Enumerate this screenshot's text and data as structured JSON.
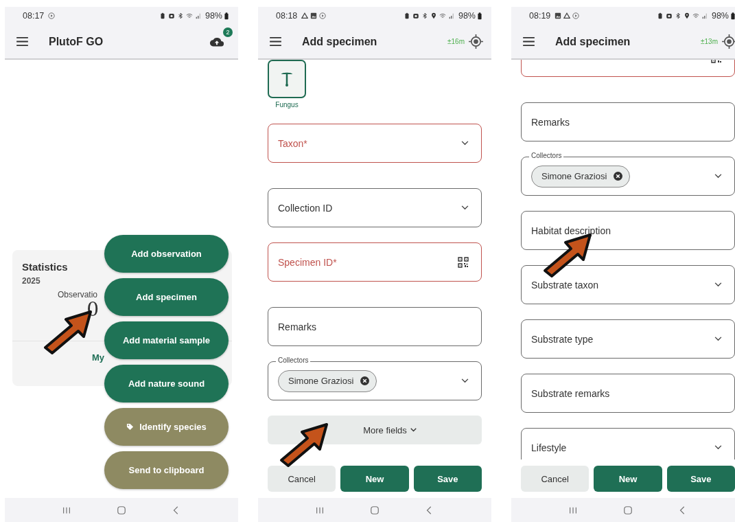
{
  "screens": [
    {
      "kind": "home",
      "status": {
        "time": "08:17",
        "battery": "98%"
      },
      "app_bar": {
        "title": "PlutoF GO",
        "upload_badge": "2"
      },
      "statistics": {
        "title": "Statistics",
        "year": "2025",
        "stat_label": "Observatio",
        "stat_value": "0",
        "link": "My"
      },
      "menu": [
        {
          "label": "Add observation",
          "kind": "primary",
          "with_icon": false
        },
        {
          "label": "Add specimen",
          "kind": "primary",
          "with_icon": false
        },
        {
          "label": "Add material sample",
          "kind": "primary",
          "with_icon": false
        },
        {
          "label": "Add nature sound",
          "kind": "primary",
          "with_icon": false
        },
        {
          "label": "Identify species",
          "kind": "secondary",
          "with_icon": true
        },
        {
          "label": "Send to clipboard",
          "kind": "secondary",
          "with_icon": false
        }
      ],
      "callout_arrow": true
    },
    {
      "kind": "form",
      "status": {
        "time": "08:18",
        "battery": "98%"
      },
      "app_bar": {
        "title": "Add specimen",
        "accuracy": "±16m"
      },
      "organism_type": {
        "label": "Fungus",
        "selected": true
      },
      "fields": [
        {
          "kind": "dropdown",
          "label": "Taxon*",
          "required": true
        },
        {
          "kind": "dropdown",
          "label": "Collection ID",
          "required": false
        },
        {
          "kind": "scan",
          "label": "Specimen ID*",
          "required": true
        },
        {
          "kind": "text",
          "label": "Remarks",
          "required": false
        },
        {
          "kind": "chips",
          "label": "Collectors",
          "required": false,
          "chips": [
            "Simone Graziosi"
          ]
        }
      ],
      "more_fields": "More fields",
      "actions": [
        {
          "label": "Cancel",
          "kind": "secondary"
        },
        {
          "label": "New",
          "kind": "primary"
        },
        {
          "label": "Save",
          "kind": "primary"
        }
      ],
      "callout_arrow": true
    },
    {
      "kind": "form",
      "status": {
        "time": "08:19",
        "battery": "98%"
      },
      "app_bar": {
        "title": "Add specimen",
        "accuracy": "±13m"
      },
      "fields": [
        {
          "kind": "scan",
          "required": true
        },
        {
          "kind": "text",
          "label": "Remarks",
          "required": false
        },
        {
          "kind": "chips",
          "label": "Collectors",
          "required": false,
          "chips": [
            "Simone Graziosi"
          ]
        },
        {
          "kind": "text",
          "label": "Habitat description",
          "required": false
        },
        {
          "kind": "dropdown",
          "label": "Substrate taxon",
          "required": false
        },
        {
          "kind": "dropdown",
          "label": "Substrate type",
          "required": false
        },
        {
          "kind": "text",
          "label": "Substrate remarks",
          "required": false
        },
        {
          "kind": "dropdown",
          "label": "Lifestyle",
          "required": false
        }
      ],
      "actions": [
        {
          "label": "Cancel",
          "kind": "secondary"
        },
        {
          "label": "New",
          "kind": "primary"
        },
        {
          "label": "Save",
          "kind": "primary"
        }
      ],
      "callout_arrow": true
    }
  ]
}
